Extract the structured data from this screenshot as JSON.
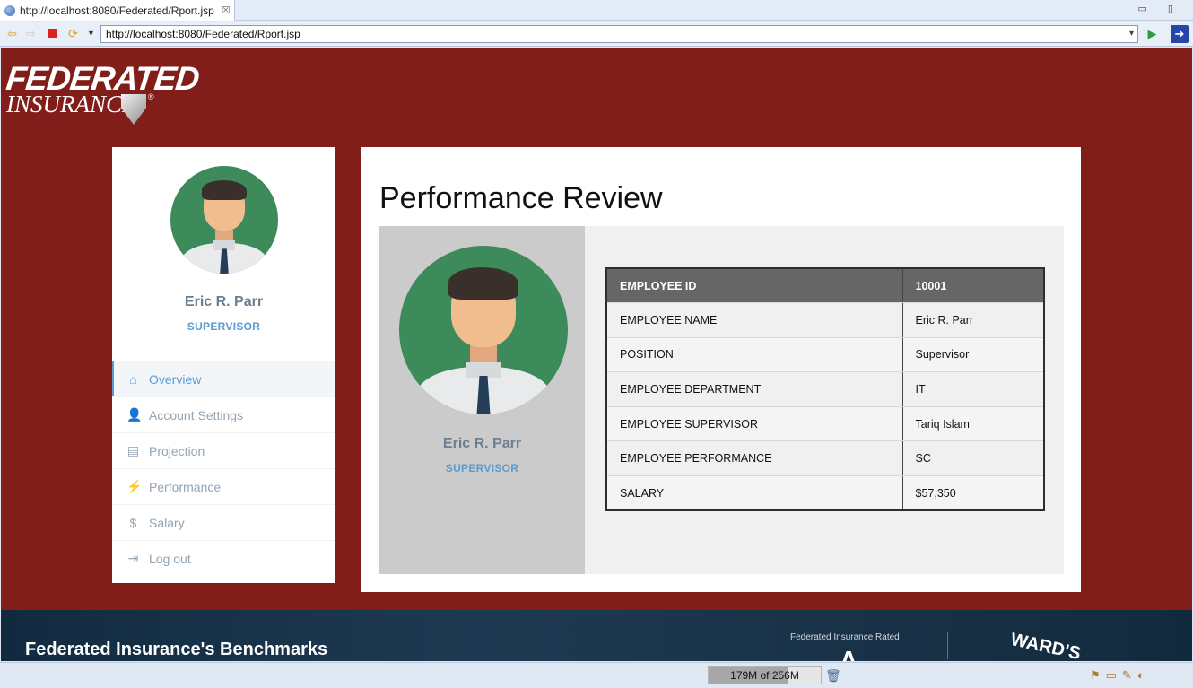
{
  "browser": {
    "tab_title": "http://localhost:8080/Federated/Rport.jsp",
    "tab_close": "☒",
    "url": "http://localhost:8080/Federated/Rport.jsp",
    "window_controls": "▭ ▯"
  },
  "logo": {
    "line1": "FEDERATED",
    "line2": "INSURANCE",
    "registered": "®"
  },
  "profile": {
    "name": "Eric R. Parr",
    "role": "SUPERVISOR"
  },
  "nav": {
    "items": [
      {
        "label": "Overview",
        "icon": "home-icon",
        "glyph": "⌂"
      },
      {
        "label": "Account Settings",
        "icon": "user-icon",
        "glyph": "👤"
      },
      {
        "label": "Projection",
        "icon": "list-icon",
        "glyph": "▤"
      },
      {
        "label": "Performance",
        "icon": "bolt-icon",
        "glyph": "⚡"
      },
      {
        "label": "Salary",
        "icon": "dollar-icon",
        "glyph": "$"
      },
      {
        "label": "Log out",
        "icon": "logout-icon",
        "glyph": "⇥"
      }
    ]
  },
  "main": {
    "title": "Performance Review",
    "card_name": "Eric R. Parr",
    "card_role": "SUPERVISOR",
    "table": [
      [
        "EMPLOYEE ID",
        "10001"
      ],
      [
        "EMPLOYEE NAME",
        "Eric R. Parr"
      ],
      [
        "POSITION",
        "Supervisor"
      ],
      [
        "EMPLOYEE DEPARTMENT",
        "IT"
      ],
      [
        "EMPLOYEE SUPERVISOR",
        "Tariq Islam"
      ],
      [
        "EMPLOYEE PERFORMANCE",
        "SC"
      ],
      [
        "SALARY",
        "$57,350"
      ]
    ]
  },
  "banner": {
    "benchmarks": "Federated Insurance's Benchmarks",
    "rated": "Federated Insurance Rated",
    "big_letter": "A",
    "wards": "WARD'S"
  },
  "status": {
    "memory": "179M of 256M",
    "memory_fraction": 0.7
  },
  "colors": {
    "brand_red": "#821e19",
    "accent_blue": "#5b9bd5",
    "avatar_green": "#3d8a5b"
  }
}
